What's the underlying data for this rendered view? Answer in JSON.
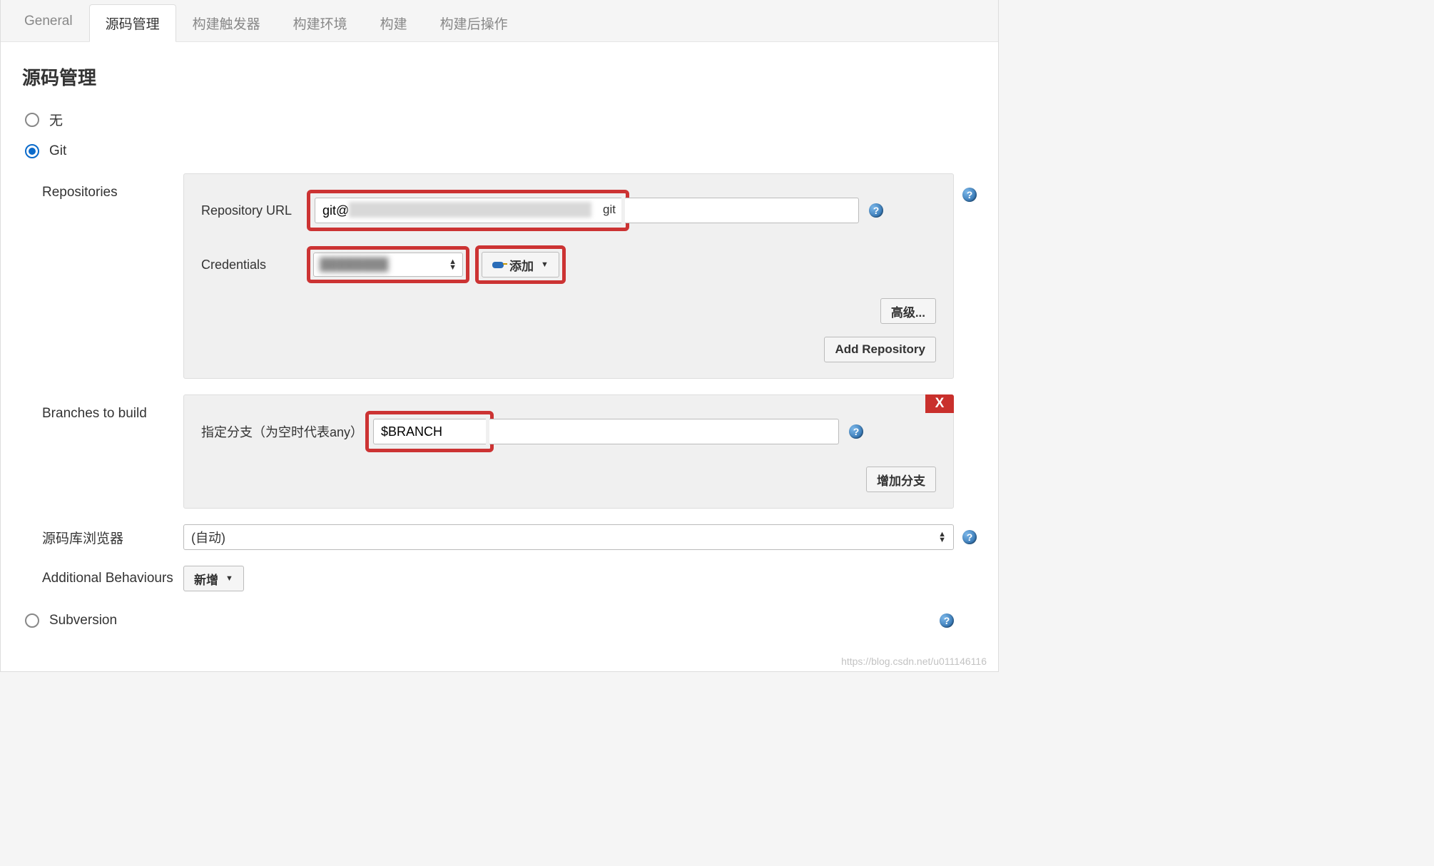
{
  "tabs": [
    "General",
    "源码管理",
    "构建触发器",
    "构建环境",
    "构建",
    "构建后操作"
  ],
  "activeTab": 1,
  "sectionTitle": "源码管理",
  "scmOptions": {
    "none": "无",
    "git": "Git",
    "svn": "Subversion"
  },
  "repositories": {
    "label": "Repositories",
    "urlLabel": "Repository URL",
    "urlPrefix": "git@",
    "urlSuffix": "git",
    "credLabel": "Credentials",
    "credValue": "████████",
    "addLabel": "添加",
    "advancedLabel": "高级...",
    "addRepoLabel": "Add Repository"
  },
  "branches": {
    "label": "Branches to build",
    "fieldLabel": "指定分支（为空时代表any）",
    "value": "$BRANCH",
    "addBranchLabel": "增加分支",
    "deleteLabel": "X"
  },
  "browser": {
    "label": "源码库浏览器",
    "value": "(自动)"
  },
  "behaviours": {
    "label": "Additional Behaviours",
    "addLabel": "新增"
  },
  "helpGlyph": "?",
  "watermark": "https://blog.csdn.net/u011146116"
}
